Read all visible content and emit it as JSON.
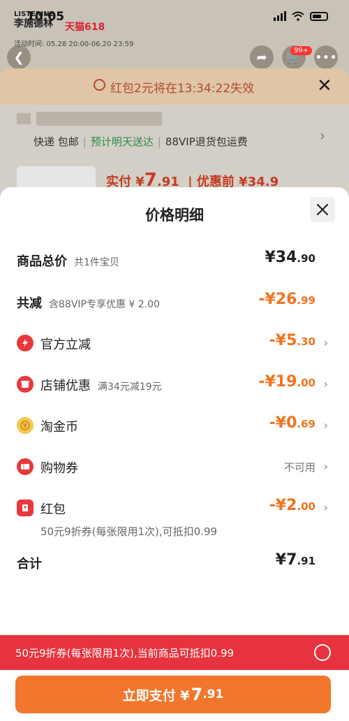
{
  "status_bar": {
    "time": "10:05"
  },
  "store": {
    "name_top": "LISTERINE",
    "name": "李施德林",
    "platform": "天猫618",
    "activity_time": "活动时间: 05.28 20:00-06.20 23:59",
    "cart_badge": "99+"
  },
  "coupon_sheet": {
    "expire_text": "红包2元将在13:34:22失效",
    "shipping": "快递 包邮",
    "delivery": "预计明天送达",
    "vip_return": "88VIP退货包运费",
    "pay_label": "实付 ¥",
    "pay_int": "7",
    "pay_dec": ".91",
    "before_label": "| 优惠前 ¥34.9"
  },
  "modal": {
    "title": "价格明细",
    "total": {
      "label": "商品总价",
      "sub": "共1件宝贝",
      "amount_int": "¥34",
      "amount_dec": ".90"
    },
    "reduce": {
      "label": "共减",
      "sub": "含88VIP专享优惠 ¥ 2.00",
      "amount_int": "-¥26",
      "amount_dec": ".99"
    },
    "items": {
      "official": {
        "label": "官方立减",
        "amount_int": "-¥5",
        "amount_dec": ".30"
      },
      "store": {
        "label": "店铺优惠",
        "sub": "满34元减19元",
        "amount_int": "-¥19",
        "amount_dec": ".00"
      },
      "taojin": {
        "label": "淘金币",
        "amount_int": "-¥0",
        "amount_dec": ".69"
      },
      "voucher": {
        "label": "购物券",
        "status": "不可用"
      },
      "redpacket": {
        "label": "红包",
        "amount_int": "-¥2",
        "amount_dec": ".00",
        "note": "50元9折券(每张限用1次),可抵扣0.99"
      }
    },
    "sum": {
      "label": "合计",
      "amount_int": "¥7",
      "amount_dec": ".91"
    }
  },
  "promo_bar": {
    "text": "50元9折券(每张限用1次),当前商品可抵扣0.99"
  },
  "pay_button": {
    "label": "立即支付 ¥",
    "amount_int": "7",
    "amount_dec": ".91"
  },
  "colors": {
    "accent_orange": "#f2731f",
    "promo_red": "#e7333f",
    "button_orange": "#f2762c"
  }
}
